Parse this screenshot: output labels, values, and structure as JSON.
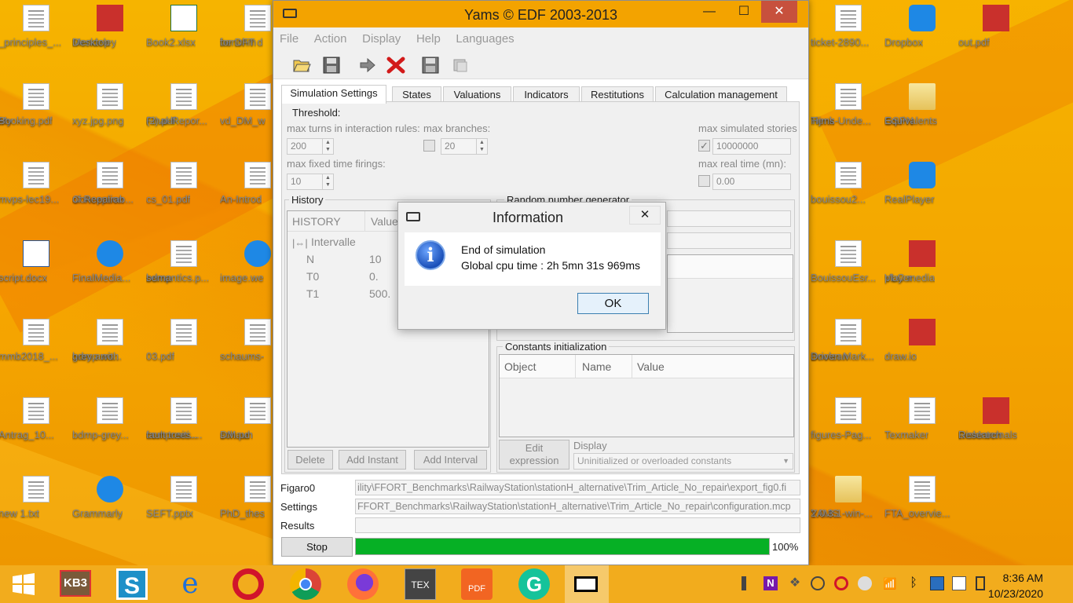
{
  "desktop": {
    "icons_left": [
      {
        "label": "_principles_...",
        "icon": "pdf-file-icon"
      },
      {
        "label": "Mendeley\nDesktop",
        "icon": "mendeley-icon"
      },
      {
        "label": "Book2.xlsx",
        "icon": "excel-file-icon"
      },
      {
        "label": "benchm\nfor DFT d",
        "icon": "pdf-file-icon"
      },
      {
        "label": "My\nBooking.pdf",
        "icon": "pdf-file-icon"
      },
      {
        "label": "xyz.jpg.png",
        "icon": "image-file-icon"
      },
      {
        "label": "Final-Repor...\n(2).pdf",
        "icon": "pdf-file-icon"
      },
      {
        "label": "vd_DM_w",
        "icon": "pdf-file-icon"
      },
      {
        "label": "mvps-lec19...",
        "icon": "pdf-file-icon"
      },
      {
        "label": "Conception\nof Repairab...",
        "icon": "pdf-file-icon"
      },
      {
        "label": "cs_01.pdf",
        "icon": "pdf-file-icon"
      },
      {
        "label": "An-Introd",
        "icon": "pdf-file-icon"
      },
      {
        "label": "script.docx",
        "icon": "word-file-icon"
      },
      {
        "label": "FinalMedia...",
        "icon": "media-player-icon"
      },
      {
        "label": "bdmp\nsemantics.p...",
        "icon": "pdf-file-icon"
      },
      {
        "label": "image.we",
        "icon": "chrome-icon"
      },
      {
        "label": "mmb2018_...",
        "icon": "pdf-file-icon"
      },
      {
        "label": "bdmp with\ngrey arro...",
        "icon": "image-file-icon"
      },
      {
        "label": "03.pdf",
        "icon": "pdf-file-icon"
      },
      {
        "label": "schaums-",
        "icon": "pdf-file-icon"
      },
      {
        "label": "Antrag_10...",
        "icon": "pdf-file-icon"
      },
      {
        "label": "bdmp-grey...",
        "icon": "image-file-icon"
      },
      {
        "label": "compositi...\nfault trees....",
        "icon": "pdf-file-icon"
      },
      {
        "label": "schaun\nDM.pd",
        "icon": "pdf-file-icon"
      },
      {
        "label": "new 1.txt",
        "icon": "text-file-icon"
      },
      {
        "label": "Grammarly",
        "icon": "grammarly-icon"
      },
      {
        "label": "SEFT.pptx",
        "icon": "pptx-file-icon"
      },
      {
        "label": "PhD_thes",
        "icon": "pdf-file-icon"
      }
    ],
    "icons_right": [
      {
        "label": "ticket-2890...",
        "icon": "pdf-file-icon"
      },
      {
        "label": "Dropbox",
        "icon": "dropbox-icon"
      },
      {
        "label": "out.pdf",
        "icon": "pdf-app-icon"
      },
      {
        "label": "Henk\nTijms-Unde...",
        "icon": "book-icon"
      },
      {
        "label": "GSPN\nEquivalents",
        "icon": "folder-icon"
      },
      {
        "label": "",
        "icon": ""
      },
      {
        "label": "bouissou2...",
        "icon": "pdf-file-icon"
      },
      {
        "label": "RealPlayer",
        "icon": "realplayer-icon"
      },
      {
        "label": "",
        "icon": ""
      },
      {
        "label": "BouissouEsr...",
        "icon": "pdf-file-icon"
      },
      {
        "label": "VLC media\nplayer",
        "icon": "vlc-icon"
      },
      {
        "label": "",
        "icon": ""
      },
      {
        "label": "Boolean\nDriven Mark...",
        "icon": "pdf-file-icon"
      },
      {
        "label": "draw.io",
        "icon": "drawio-icon"
      },
      {
        "label": "",
        "icon": ""
      },
      {
        "label": "figures-Pag...",
        "icon": "pdf-file-icon"
      },
      {
        "label": "Texmaker",
        "icon": "texmaker-icon"
      },
      {
        "label": "DiskInternals\nResearch",
        "icon": "diskinternals-icon"
      },
      {
        "label": "YAMS\n2.0.3.1-win-...",
        "icon": "folder-icon"
      },
      {
        "label": "FTA_overvie...",
        "icon": "pdf-file-icon"
      },
      {
        "label": "",
        "icon": ""
      }
    ]
  },
  "window": {
    "title": "Yams © EDF 2003-2013",
    "minimize": "—",
    "maximize": "☐",
    "close": "✕"
  },
  "menu": [
    "File",
    "Action",
    "Display",
    "Help",
    "Languages"
  ],
  "tabs": [
    "Simulation Settings",
    "States",
    "Valuations",
    "Indicators",
    "Restitutions",
    "Calculation management"
  ],
  "threshold": {
    "title": "Threshold:",
    "max_turns_label": "max turns in interaction rules:",
    "max_turns_value": "200",
    "max_branches_label": "max branches:",
    "max_branches_value": "20",
    "max_stories_label": "max simulated stories",
    "max_stories_value": "10000000",
    "max_fixed_label": "max fixed time firings:",
    "max_fixed_value": "10",
    "max_real_label": "max real time (mn):",
    "max_real_value": "0.00"
  },
  "history": {
    "title": "History",
    "col_history": "HISTORY",
    "col_value": "Value",
    "group": "Intervalle",
    "rows": [
      {
        "name": "N",
        "value": "10"
      },
      {
        "name": "T0",
        "value": "0."
      },
      {
        "name": "T1",
        "value": "500."
      }
    ],
    "delete_label": "Delete",
    "add_instant_label": "Add Instant",
    "add_interval_label": "Add Interval"
  },
  "rng": {
    "title": "Random number generator"
  },
  "constants": {
    "title": "Constants initialization",
    "col_object": "Object",
    "col_name": "Name",
    "col_value": "Value",
    "edit_label": "Edit\nexpression",
    "display_label": "Display",
    "display_value": "Uninitialized or overloaded constants"
  },
  "status": {
    "figaro_label": "Figaro0",
    "figaro_path": "ility\\FFORT_Benchmarks\\RailwayStation\\stationH_alternative\\Trim_Article_No_repair\\export_fig0.fi",
    "settings_label": "Settings",
    "settings_path": "FFORT_Benchmarks\\RailwayStation\\stationH_alternative\\Trim_Article_No_repair\\configuration.mcp",
    "results_label": "Results",
    "results_path": "",
    "stop_label": "Stop",
    "progress": 100,
    "progress_text": "100%",
    "progress_color": "#06b025"
  },
  "dialog": {
    "title": "Information",
    "close": "✕",
    "line1": "End of simulation",
    "line2": "Global cpu time : 2h 5mn 31s 969ms",
    "ok_label": "OK",
    "icon_glyph": "i"
  },
  "taskbar": {
    "start_icon": "windows-start-icon",
    "kb3_label": "KB3",
    "clock_time": "8:36 AM",
    "clock_date": "10/23/2020"
  },
  "colors": {
    "desktop": "#f3a300",
    "taskbar": "#f2ac1d",
    "titlebar": "#f3a300",
    "close_button": "#c7513d"
  }
}
